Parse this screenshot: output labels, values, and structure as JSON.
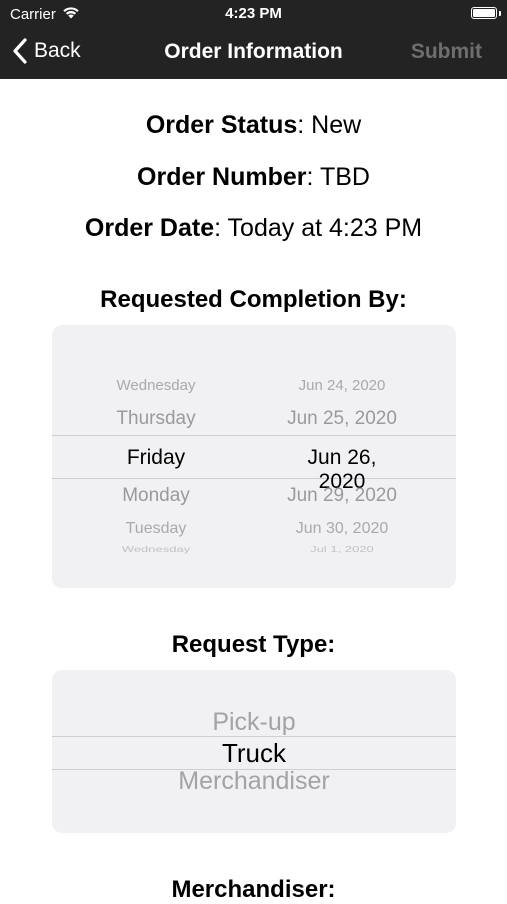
{
  "status_bar": {
    "carrier": "Carrier",
    "time": "4:23 PM"
  },
  "nav": {
    "back_label": "Back",
    "title": "Order Information",
    "submit_label": "Submit"
  },
  "order": {
    "status_label": "Order Status",
    "status_value": ": New",
    "number_label": "Order Number",
    "number_value": ": TBD",
    "date_label": "Order Date",
    "date_value": ": Today at 4:23 PM"
  },
  "completion": {
    "heading": "Requested Completion By:",
    "rows": [
      {
        "day": "Wednesday",
        "date": "Jun 24, 2020"
      },
      {
        "day": "Thursday",
        "date": "Jun 25, 2020"
      },
      {
        "day": "Friday",
        "date": "Jun 26, 2020"
      },
      {
        "day": "Monday",
        "date": "Jun 29, 2020"
      },
      {
        "day": "Tuesday",
        "date": "Jun 30, 2020"
      },
      {
        "day": "Wednesday",
        "date": "Jul 1, 2020"
      }
    ],
    "selected_index": 2
  },
  "request_type": {
    "heading": "Request Type:",
    "options": [
      "Pick-up",
      "Truck",
      "Merchandiser"
    ],
    "selected_index": 1
  },
  "merchandiser": {
    "heading": "Merchandiser:"
  },
  "colors": {
    "bar_background": "#232323",
    "picker_background": "#f1f1f3",
    "disabled_text": "#6e6e6e"
  }
}
